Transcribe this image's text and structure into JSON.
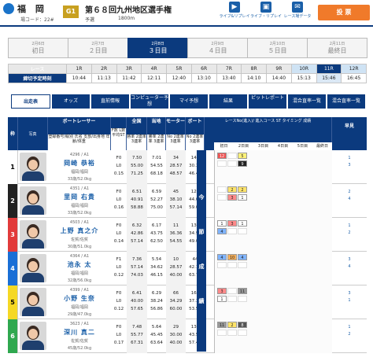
{
  "header": {
    "venue": "福 岡",
    "venue_code": "場コード：22#",
    "grade": "G1",
    "title": "第６８回九州地区選手権",
    "meta": "予選",
    "distance": "1800m",
    "icons": [
      {
        "name": "live-icon",
        "label": "ライブ&リプレイ"
      },
      {
        "name": "pc-icon",
        "label": "ライブ・リプレイ"
      },
      {
        "name": "mail-icon",
        "label": "レース場データ"
      }
    ],
    "vote": "投 票"
  },
  "days": [
    {
      "date": "2月6日",
      "label": "初日"
    },
    {
      "date": "2月7日",
      "label": "２日目"
    },
    {
      "date": "2月8日",
      "label": "３日目"
    },
    {
      "date": "2月9日",
      "label": "４日目"
    },
    {
      "date": "2月10日",
      "label": "５日目"
    },
    {
      "date": "2月11日",
      "label": "最終日"
    }
  ],
  "active_day": 2,
  "races": {
    "header_label": "レース",
    "time_label": "締切予定時刻",
    "numbers": [
      "1R",
      "2R",
      "3R",
      "4R",
      "5R",
      "6R",
      "7R",
      "8R",
      "9R",
      "10R",
      "11R",
      "12R"
    ],
    "times": [
      "10:44",
      "11:13",
      "11:42",
      "12:11",
      "12:40",
      "13:10",
      "13:40",
      "14:10",
      "14:40",
      "15:13",
      "15:46",
      "16:45"
    ],
    "current": 10
  },
  "tabs": [
    "出走表",
    "オッズ",
    "直前情報",
    "コンピューター予想",
    "マイ予想",
    "結果",
    "ピットレポート",
    "混合直率一覧",
    "混合直率一覧"
  ],
  "table_headers": {
    "lane": "枠",
    "photo": "写真",
    "racer": "ボートレーサー",
    "racer_sub": "登録番号/級別 氏名 支部/出身地 年齢/体重",
    "fl": "F数 L数 平均ST",
    "national": "全国",
    "local": "当地",
    "motor": "モーター",
    "boat": "ボート",
    "rate_sub": "勝率 2連率 3連率",
    "mno_sub": "No 2連率 3連率",
    "past": "レースNo(進入)/ 進入コース ST タイミング 成績",
    "early": "早見"
  },
  "past_cols": [
    "初日",
    "2日目",
    "3日目",
    "4日目",
    "5日目",
    "最終日"
  ],
  "today_label": "今 節 成 績",
  "racers": [
    {
      "lane": "1",
      "no": "4296 / A1",
      "name": "岡崎 恭裕",
      "branch": "福岡/福岡",
      "age": "33歳/52.0kg",
      "fl": [
        "F0",
        "L0",
        "0.15"
      ],
      "national": [
        "7.50",
        "55.00",
        "71.25"
      ],
      "local": [
        "7.01",
        "54.55",
        "68.18"
      ],
      "motor": [
        "34",
        "28.57",
        "48.57"
      ],
      "boat": [
        "149",
        "30.30",
        "46.46"
      ],
      "past": [
        [
          "12",
          "",
          "5"
        ],
        [
          "",
          "",
          "9"
        ]
      ],
      "early": [
        "1",
        "3"
      ],
      "color": "#fff",
      "text": "#000"
    },
    {
      "lane": "2",
      "no": "4351 / A1",
      "name": "里岡 右貴",
      "branch": "福岡/福岡",
      "age": "33歳/52.0kg",
      "fl": [
        "F0",
        "L0",
        "0.16"
      ],
      "national": [
        "6.51",
        "40.91",
        "58.88"
      ],
      "local": [
        "6.59",
        "52.27",
        "75.00"
      ],
      "motor": [
        "45",
        "38.10",
        "57.14"
      ],
      "boat": [
        "120",
        "44.00",
        "59.00"
      ],
      "past": [
        [
          "",
          "2",
          "2"
        ],
        [
          "",
          "3",
          "1"
        ]
      ],
      "early": [
        "2",
        "4"
      ],
      "color": "#222",
      "text": "#fff"
    },
    {
      "lane": "3",
      "no": "4503 / A1",
      "name": "上野 真之介",
      "branch": "佐賀/佐賀",
      "age": "30歳/51.0kg",
      "fl": [
        "F0",
        "L0",
        "0.14"
      ],
      "national": [
        "6.32",
        "42.86",
        "57.14"
      ],
      "local": [
        "6.17",
        "43.75",
        "62.50"
      ],
      "motor": [
        "11",
        "36.36",
        "54.55"
      ],
      "boat": [
        "139",
        "34.91",
        "49.06"
      ],
      "past": [
        [
          "1",
          "3",
          "1"
        ],
        [
          "4",
          "",
          ""
        ]
      ],
      "early": [
        "1",
        "2"
      ],
      "color": "#e23b3b",
      "text": "#fff"
    },
    {
      "lane": "4",
      "no": "4364 / A1",
      "name": "池永 太",
      "branch": "福岡/福岡",
      "age": "32歳/56.0kg",
      "fl": [
        "F1",
        "L0",
        "0.12"
      ],
      "national": [
        "7.36",
        "57.14",
        "74.03"
      ],
      "local": [
        "5.54",
        "34.62",
        "46.15"
      ],
      "motor": [
        "10",
        "28.57",
        "40.00"
      ],
      "boat": [
        "44",
        "42.16",
        "63.73"
      ],
      "past": [
        [
          "4",
          "10",
          "4"
        ],
        [
          "",
          "",
          ""
        ]
      ],
      "early": [
        "3",
        "4"
      ],
      "color": "#1a6fd6",
      "text": "#fff"
    },
    {
      "lane": "5",
      "no": "4399 / A1",
      "name": "小野 生奈",
      "branch": "福岡/福岡",
      "age": "29歳/47.0kg",
      "fl": [
        "F0",
        "L0",
        "0.12"
      ],
      "national": [
        "6.41",
        "40.00",
        "57.65"
      ],
      "local": [
        "6.29",
        "38.24",
        "56.86"
      ],
      "motor": [
        "66",
        "34.29",
        "60.00"
      ],
      "boat": [
        "165",
        "37.37",
        "53.54"
      ],
      "past": [
        [
          "3",
          "",
          "11"
        ],
        [
          "1",
          "",
          ""
        ]
      ],
      "early": [
        "3",
        "1"
      ],
      "color": "#f5d824",
      "text": "#000"
    },
    {
      "lane": "6",
      "no": "3623 / A1",
      "name": "深川 真二",
      "branch": "佐賀/佐賀",
      "age": "45歳/52.0kg",
      "fl": [
        "F0",
        "L0",
        "0.17"
      ],
      "national": [
        "7.48",
        "55.77",
        "67.31"
      ],
      "local": [
        "5.64",
        "45.45",
        "63.64"
      ],
      "motor": [
        "29",
        "30.00",
        "40.00"
      ],
      "boat": [
        "131",
        "43.56",
        "57.43"
      ],
      "past": [
        [
          "11",
          "2",
          "8"
        ],
        [
          "",
          "",
          ""
        ]
      ],
      "early": [
        "1",
        "2"
      ],
      "color": "#2fa84f",
      "text": "#fff"
    }
  ]
}
